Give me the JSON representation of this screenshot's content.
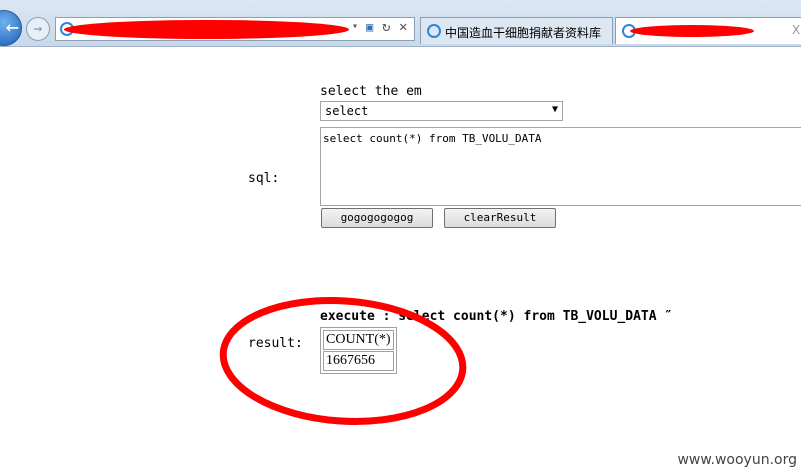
{
  "browser": {
    "tabs": [
      {
        "label": "中国造血干细胞捐献者资料库"
      },
      {
        "label": ""
      }
    ],
    "close_glyph": "X"
  },
  "form": {
    "select_label": "select the em",
    "select_value": "select",
    "sql_label": "sql:",
    "sql_value": "select count(*) from TB_VOLU_DATA",
    "go_button": "gogogogogog",
    "clear_button": "clearResult"
  },
  "result": {
    "execute_text": "execute : select count(*) from TB_VOLU_DATA ″",
    "label": "result:",
    "columns": [
      "COUNT(*)"
    ],
    "rows": [
      [
        "1667656"
      ]
    ]
  },
  "annotation_color": "#ff0000",
  "watermark": "www.wooyun.org"
}
